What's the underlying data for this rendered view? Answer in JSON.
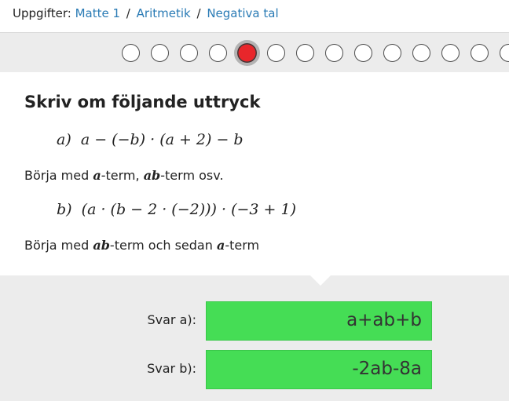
{
  "breadcrumb": {
    "label": "Uppgifter:",
    "sep": "/",
    "items": [
      "Matte 1",
      "Aritmetik",
      "Negativa tal"
    ]
  },
  "stepper": {
    "count": 14,
    "active_index": 4,
    "active_color": "#e8262b"
  },
  "question": {
    "title": "Skriv om följande uttryck",
    "a_label": "a)",
    "a_expr": "a − (−b) · (a + 2) − b",
    "hint_a_pre": "Börja med ",
    "hint_a_var1": "a",
    "hint_a_mid": "-term, ",
    "hint_a_var2": "ab",
    "hint_a_post": "-term osv.",
    "b_label": "b)",
    "b_expr": "(a · (b − 2 · (−2))) · (−3 + 1)",
    "hint_b_pre": "Börja med ",
    "hint_b_var1": "ab",
    "hint_b_mid": "-term och sedan ",
    "hint_b_var2": "a",
    "hint_b_post": "-term"
  },
  "answers": {
    "a_label": "Svar a):",
    "a_value": "a+ab+b",
    "b_label": "Svar b):",
    "b_value": "-2ab-8a",
    "correct_color": "#45dd55"
  }
}
